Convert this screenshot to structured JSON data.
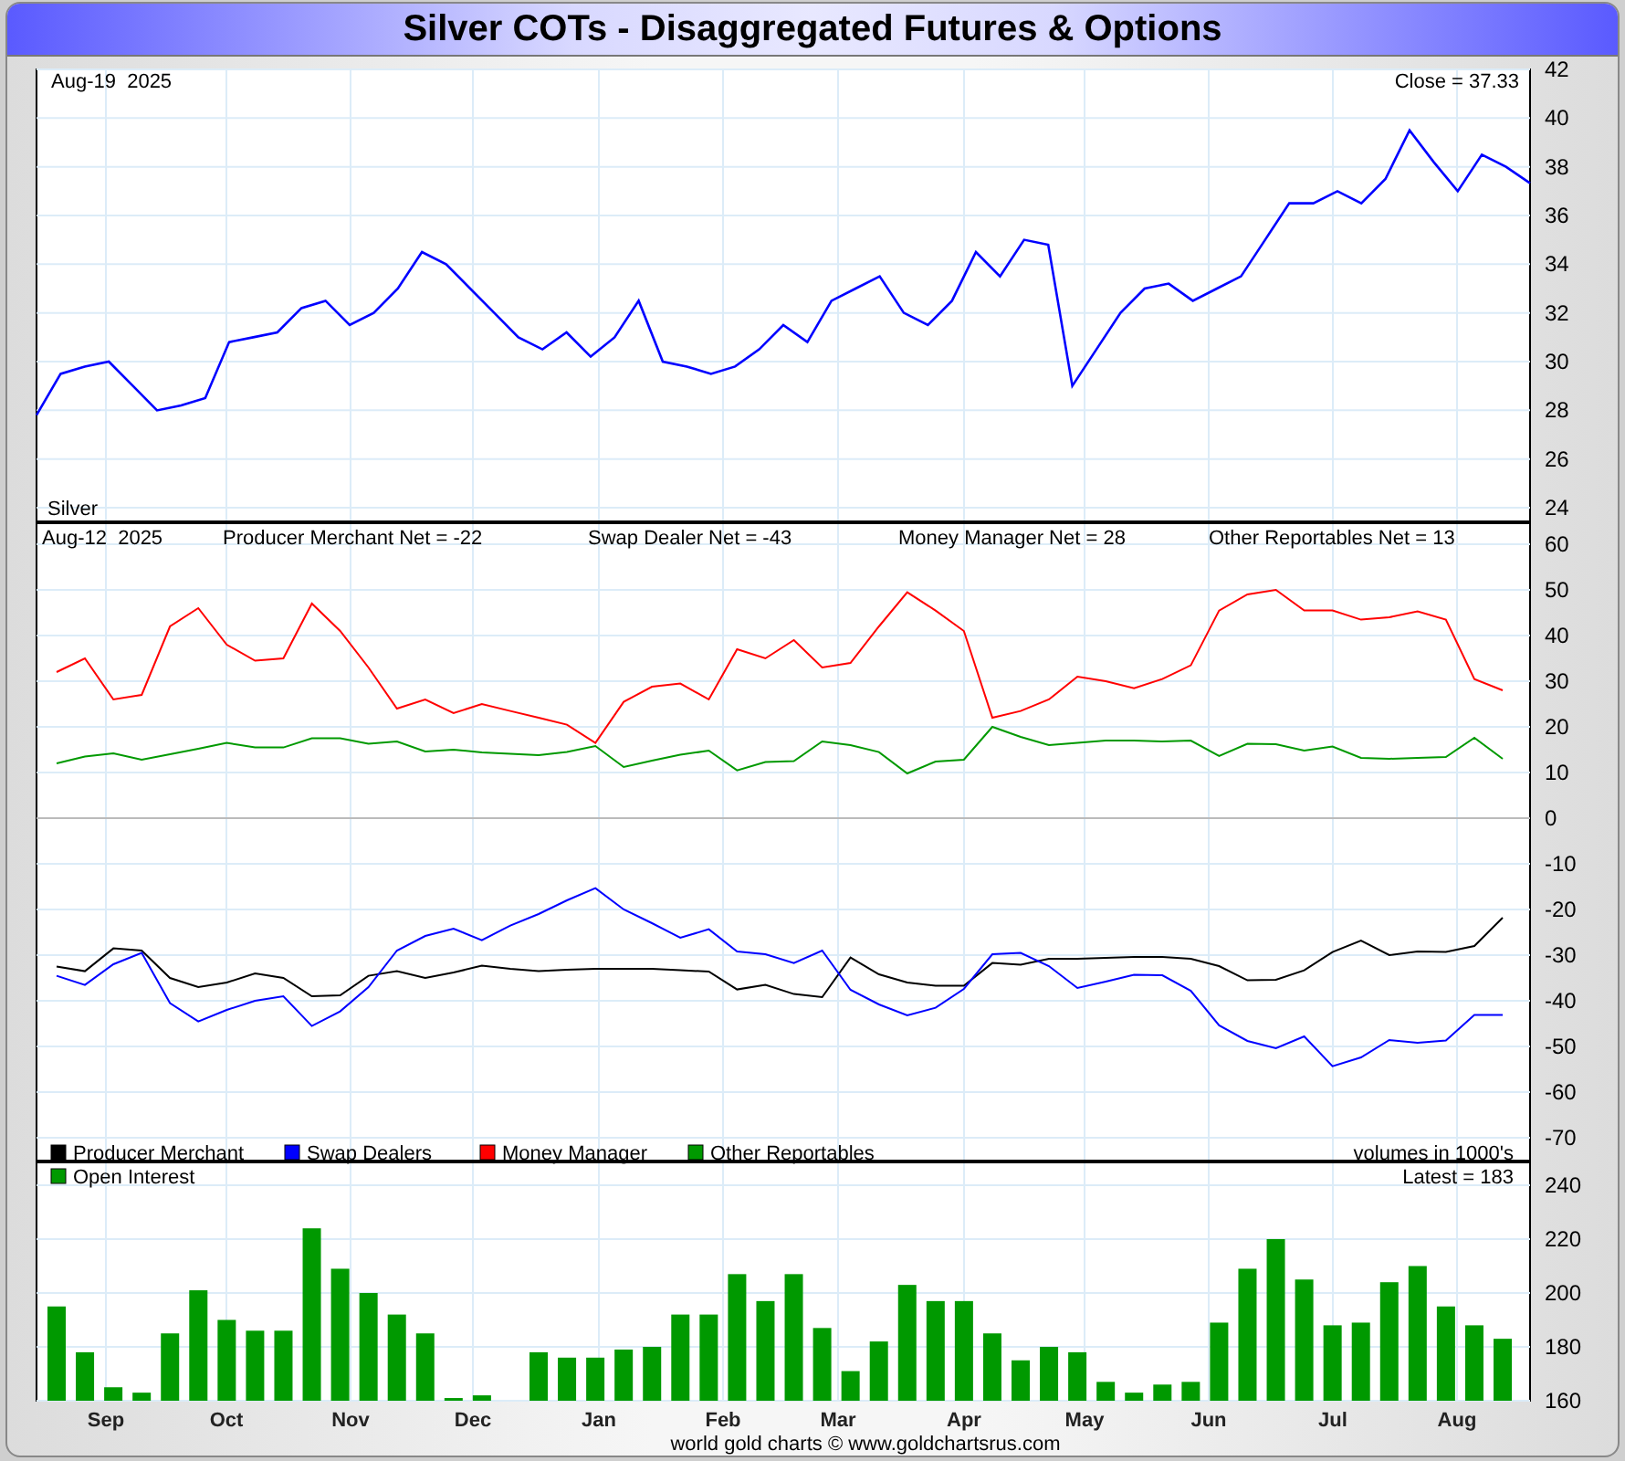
{
  "title": "Silver COTs - Disaggregated Futures & Options",
  "panels": [
    {
      "kind": "price",
      "date": "Aug-19  2025",
      "reading": "Close = 37.33",
      "chart_data": {
        "type": "line",
        "grid": true,
        "ylim": [
          24,
          42
        ],
        "yticks": [
          24,
          26,
          28,
          30,
          32,
          34,
          36,
          38,
          40,
          42
        ],
        "series": [
          {
            "name": "Silver",
            "color": "#0000ff",
            "values": [
              27.8,
              29.5,
              29.8,
              30,
              29,
              28,
              28.2,
              28.5,
              30.8,
              31,
              31.2,
              32.2,
              32.5,
              31.5,
              32,
              33,
              34.5,
              34,
              33,
              32,
              31,
              30.5,
              31.2,
              30.2,
              31,
              32.5,
              30,
              29.8,
              29.5,
              29.8,
              30.5,
              31.5,
              30.8,
              32.5,
              33,
              33.5,
              32,
              31.5,
              32.5,
              34.5,
              33.5,
              35,
              34.8,
              29,
              30.5,
              32,
              33,
              33.2,
              32.5,
              33,
              33.5,
              35,
              36.5,
              36.5,
              37,
              36.5,
              37.5,
              39.5,
              38.2,
              37,
              38.5,
              38,
              37.33
            ]
          }
        ]
      }
    },
    {
      "kind": "cot",
      "date": "Aug-12  2025",
      "readings": [
        "Producer Merchant Net = -22",
        "Swap Dealer Net = -43",
        "Money Manager Net = 28",
        "Other Reportables Net = 13"
      ],
      "note": "volumes in 1000's",
      "chart_data": {
        "type": "line",
        "grid": true,
        "legend": "bottom",
        "ylim": [
          -70,
          60
        ],
        "yticks": [
          -70,
          -60,
          -50,
          -40,
          -30,
          -20,
          -10,
          0,
          10,
          20,
          30,
          40,
          50,
          60
        ],
        "series": [
          {
            "name": "Producer Merchant",
            "color": "#000000",
            "values": [
              -32.5,
              -33.5,
              -28.5,
              -29,
              -35,
              -37,
              -36,
              -34,
              -35,
              -39,
              -38.8,
              -34.5,
              -33.5,
              -35,
              -33.8,
              -32.3,
              -33,
              -33.5,
              -33.2,
              -33,
              -33,
              -33,
              -33.3,
              -33.6,
              -37.5,
              -36.5,
              -38.5,
              -39.2,
              -30.5,
              -34.2,
              -36,
              -36.7,
              -36.7,
              -31.7,
              -32.1,
              -30.8,
              -30.8,
              -30.6,
              -30.4,
              -30.4,
              -30.8,
              -32.4,
              -35.5,
              -35.4,
              -33.3,
              -29.3,
              -26.8,
              -30,
              -29.2,
              -29.3,
              -28,
              -21.8
            ]
          },
          {
            "name": "Swap Dealers",
            "color": "#0000ff",
            "values": [
              -34.5,
              -36.5,
              -32,
              -29.5,
              -40.5,
              -44.5,
              -42,
              -40,
              -39,
              -45.5,
              -42.3,
              -37,
              -29,
              -25.8,
              -24.2,
              -26.7,
              -23.5,
              -21,
              -18,
              -15.3,
              -20,
              -23,
              -26.2,
              -24.3,
              -29.2,
              -29.8,
              -31.7,
              -29,
              -37.6,
              -40.8,
              -43.2,
              -41.5,
              -37.4,
              -29.8,
              -29.5,
              -32.4,
              -37.2,
              -35.8,
              -34.3,
              -34.4,
              -37.8,
              -45.4,
              -48.8,
              -50.4,
              -47.8,
              -54.3,
              -52.4,
              -48.6,
              -49.2,
              -48.7,
              -43.1,
              -43.1
            ]
          },
          {
            "name": "Money Manager",
            "color": "#ff0000",
            "values": [
              32,
              35,
              26,
              27,
              42,
              46,
              38,
              34.5,
              35,
              47,
              41,
              33,
              24,
              26,
              23,
              25,
              23.5,
              22,
              20.5,
              16.5,
              25.5,
              28.8,
              29.5,
              26,
              37,
              35,
              39,
              33,
              34,
              42,
              49.5,
              45.5,
              41,
              22,
              23.5,
              26,
              31,
              30,
              28.5,
              30.5,
              33.5,
              45.5,
              49,
              50,
              45.5,
              45.5,
              43.5,
              44,
              45.3,
              43.5,
              30.5,
              28
            ]
          },
          {
            "name": "Other Reportables",
            "color": "#009900",
            "values": [
              12,
              13.5,
              14.2,
              12.8,
              14,
              15.2,
              16.5,
              15.5,
              15.5,
              17.5,
              17.5,
              16.3,
              16.8,
              14.6,
              15,
              14.4,
              14.1,
              13.8,
              14.5,
              15.8,
              11.2,
              12.6,
              13.9,
              14.8,
              10.5,
              12.3,
              12.5,
              16.8,
              16,
              14.5,
              9.8,
              12.4,
              12.8,
              20,
              17.8,
              16,
              16.5,
              17,
              17,
              16.8,
              17,
              13.6,
              16.3,
              16.2,
              14.8,
              15.7,
              13.2,
              13,
              13.2,
              13.4,
              17.6,
              13
            ]
          }
        ]
      }
    },
    {
      "kind": "oi",
      "reading": "Latest = 183",
      "chart_data": {
        "type": "bar",
        "grid": true,
        "legend": "top",
        "ylim": [
          160,
          240
        ],
        "yticks": [
          160,
          180,
          200,
          220,
          240
        ],
        "series": [
          {
            "name": "Open Interest",
            "color": "#009900",
            "values": [
              195,
              178,
              165,
              163,
              185,
              201,
              190,
              186,
              186,
              224,
              209,
              200,
              192,
              185,
              161,
              162,
              null,
              178,
              176,
              176,
              179,
              180,
              192,
              192,
              207,
              197,
              207,
              187,
              171,
              182,
              203,
              197,
              197,
              185,
              175,
              180,
              178,
              167,
              163,
              166,
              167,
              189,
              209,
              220,
              205,
              188,
              189,
              204,
              210,
              195,
              188,
              183
            ]
          }
        ]
      }
    }
  ],
  "months": [
    "Sep",
    "Oct",
    "Nov",
    "Dec",
    "Jan",
    "Feb",
    "Mar",
    "Apr",
    "May",
    "Jun",
    "Jul",
    "Aug"
  ],
  "credit": "world gold charts © www.goldchartsrus.com"
}
